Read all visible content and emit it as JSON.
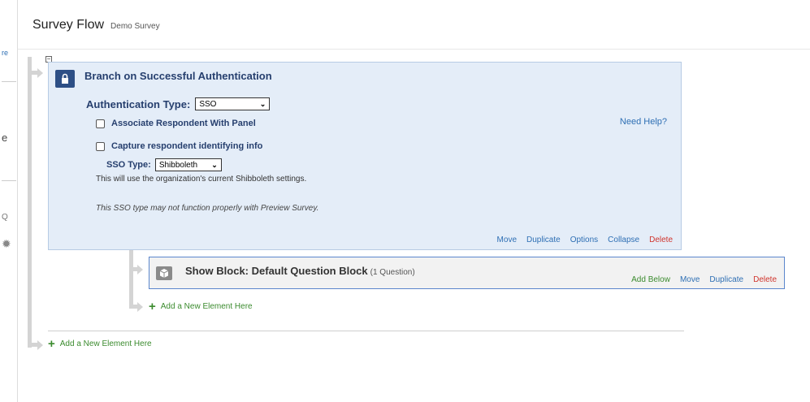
{
  "header": {
    "title": "Survey Flow",
    "subtitle": "Demo Survey"
  },
  "edge_fragments": [
    "re",
    "e",
    "Q"
  ],
  "branch": {
    "title": "Branch on Successful Authentication",
    "auth_type_label": "Authentication Type:",
    "auth_type_value": "SSO",
    "associate_label": "Associate Respondent With Panel",
    "associate_checked": false,
    "capture_label": "Capture respondent identifying info",
    "capture_checked": false,
    "need_help": "Need Help?",
    "sso_type_label": "SSO Type:",
    "sso_type_value": "Shibboleth",
    "sso_note": "This will use the organization's current Shibboleth settings.",
    "preview_note": "This SSO type may not function properly with Preview Survey.",
    "actions": {
      "move": "Move",
      "duplicate": "Duplicate",
      "options": "Options",
      "collapse": "Collapse",
      "delete": "Delete"
    }
  },
  "block": {
    "title": "Show Block: Default Question Block",
    "count": "(1 Question)",
    "actions": {
      "add_below": "Add Below",
      "move": "Move",
      "duplicate": "Duplicate",
      "delete": "Delete"
    }
  },
  "add_element_inner": "Add a New Element Here",
  "add_element_outer": "Add a New Element Here",
  "colors": {
    "branch_bg": "#e4edf8",
    "accent_blue": "#2e6fb4",
    "delete_red": "#d0342c",
    "add_green": "#3b8b2e",
    "title_navy": "#263f6e"
  }
}
